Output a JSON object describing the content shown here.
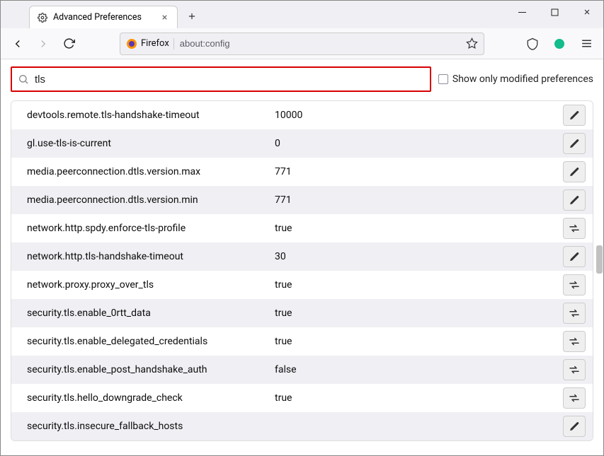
{
  "window": {
    "tab_title": "Advanced Preferences"
  },
  "urlbar": {
    "identity_label": "Firefox",
    "url": "about:config"
  },
  "search": {
    "value": "tls",
    "checkbox_label": "Show only modified preferences"
  },
  "prefs": [
    {
      "name": "devtools.remote.tls-handshake-timeout",
      "value": "10000",
      "action": "edit"
    },
    {
      "name": "gl.use-tls-is-current",
      "value": "0",
      "action": "edit"
    },
    {
      "name": "media.peerconnection.dtls.version.max",
      "value": "771",
      "action": "edit"
    },
    {
      "name": "media.peerconnection.dtls.version.min",
      "value": "771",
      "action": "edit"
    },
    {
      "name": "network.http.spdy.enforce-tls-profile",
      "value": "true",
      "action": "toggle"
    },
    {
      "name": "network.http.tls-handshake-timeout",
      "value": "30",
      "action": "edit"
    },
    {
      "name": "network.proxy.proxy_over_tls",
      "value": "true",
      "action": "toggle"
    },
    {
      "name": "security.tls.enable_0rtt_data",
      "value": "true",
      "action": "toggle"
    },
    {
      "name": "security.tls.enable_delegated_credentials",
      "value": "true",
      "action": "toggle"
    },
    {
      "name": "security.tls.enable_post_handshake_auth",
      "value": "false",
      "action": "toggle"
    },
    {
      "name": "security.tls.hello_downgrade_check",
      "value": "true",
      "action": "toggle"
    },
    {
      "name": "security.tls.insecure_fallback_hosts",
      "value": "",
      "action": "edit"
    }
  ],
  "icons": {
    "pencil": "edit-icon",
    "toggle": "toggle-icon"
  }
}
